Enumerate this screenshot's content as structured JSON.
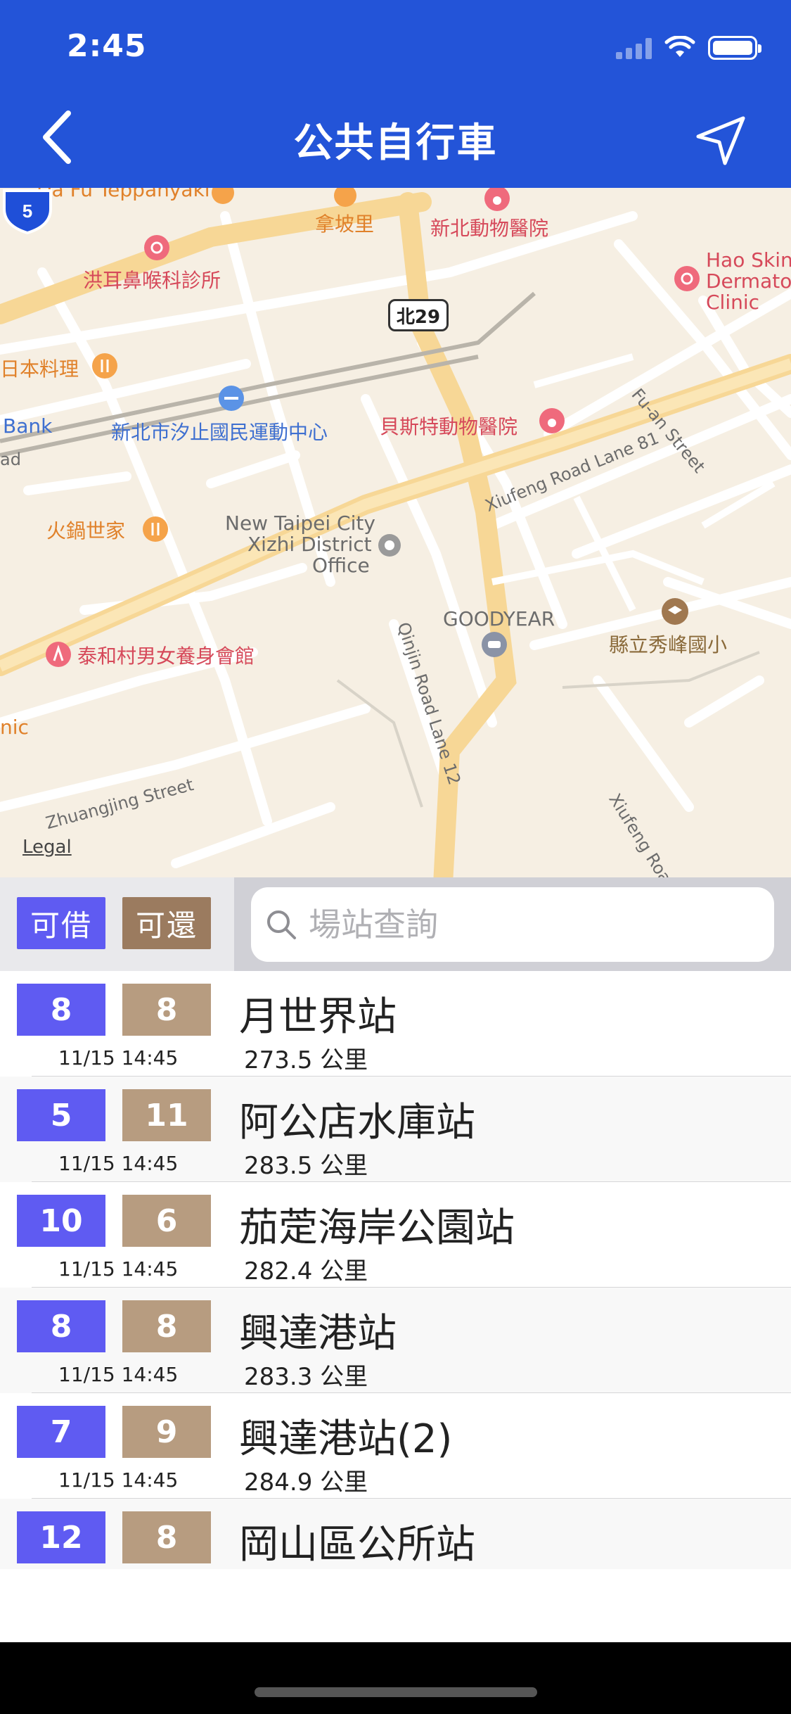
{
  "status_bar": {
    "time": "2:45"
  },
  "nav": {
    "title": "公共自行車"
  },
  "map": {
    "labels": {
      "teppanyaki": "Da Fu Teppanyaki",
      "napoli": "拿坡里",
      "xinbei_vet": "新北動物醫院",
      "ent_clinic": "洪耳鼻喉科診所",
      "hao_skin_1": "Hao Skin",
      "hao_skin_2": "Dermato",
      "hao_skin_3": "Clinic",
      "japanese": "日本料理",
      "bank": "Bank",
      "sports_center": "新北市汐止國民運動中心",
      "best_vet": "貝斯特動物醫院",
      "fuan_street": "Fu-an Street",
      "xiufeng_lane": "Xiufeng Road Lane 81",
      "hotpot": "火鍋世家",
      "district_office_1": "New Taipei City",
      "district_office_2": "Xizhi District",
      "district_office_3": "Office",
      "goodyear": "GOODYEAR",
      "xiufeng_school": "縣立秀峰國小",
      "gym": "泰和村男女養身會館",
      "qinjin_lane": "Qinjin Road Lane 12",
      "clinic_edge": "nic",
      "zhuangjing": "Zhuangjing Street",
      "xiufeng_road": "Xiufeng Road",
      "road_edge": "ad"
    },
    "route_shield": "北29",
    "highway_shield": "5",
    "legal": "Legal"
  },
  "controls": {
    "borrow_label": "可借",
    "return_label": "可還",
    "search_placeholder": "場站查詢"
  },
  "stations": [
    {
      "available": "8",
      "returnable": "8",
      "time": "11/15 14:45",
      "name": "月世界站",
      "distance": "273.5 公里"
    },
    {
      "available": "5",
      "returnable": "11",
      "time": "11/15 14:45",
      "name": "阿公店水庫站",
      "distance": "283.5 公里"
    },
    {
      "available": "10",
      "returnable": "6",
      "time": "11/15 14:45",
      "name": "茄萣海岸公園站",
      "distance": "282.4 公里"
    },
    {
      "available": "8",
      "returnable": "8",
      "time": "11/15 14:45",
      "name": "興達港站",
      "distance": "283.3 公里"
    },
    {
      "available": "7",
      "returnable": "9",
      "time": "11/15 14:45",
      "name": "興達港站(2)",
      "distance": "284.9 公里"
    },
    {
      "available": "12",
      "returnable": "8",
      "time": "",
      "name": "岡山區公所站",
      "distance": ""
    }
  ],
  "colors": {
    "nav_bg": "#2354d8",
    "available": "#5f5bf2",
    "returnable": "#b79c80"
  }
}
